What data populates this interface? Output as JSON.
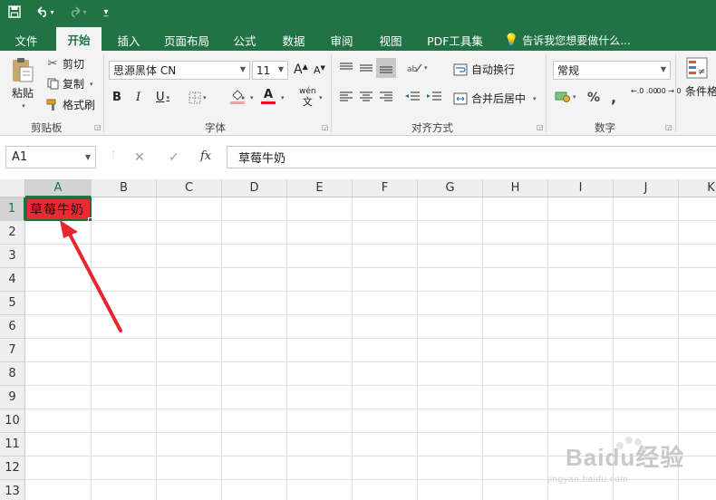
{
  "quick_access": {
    "save_icon": "save-icon",
    "undo_icon": "undo-icon",
    "redo_icon": "redo-icon",
    "customize_icon": "customize-icon"
  },
  "tabs": [
    {
      "label": "文件",
      "active": false
    },
    {
      "label": "开始",
      "active": true
    },
    {
      "label": "插入",
      "active": false
    },
    {
      "label": "页面布局",
      "active": false
    },
    {
      "label": "公式",
      "active": false
    },
    {
      "label": "数据",
      "active": false
    },
    {
      "label": "审阅",
      "active": false
    },
    {
      "label": "视图",
      "active": false
    },
    {
      "label": "PDF工具集",
      "active": false
    }
  ],
  "tell_me": "告诉我您想要做什么...",
  "ribbon": {
    "clipboard": {
      "paste": "粘贴",
      "cut": "剪切",
      "copy": "复制",
      "format_painter": "格式刷",
      "label": "剪贴板"
    },
    "font": {
      "font_name": "思源黑体 CN",
      "font_size": "11",
      "bold": "B",
      "italic": "I",
      "underline": "U",
      "font_color_letter": "A",
      "grow": "A",
      "shrink": "A",
      "wen": "wén",
      "wen_char": "文",
      "label": "字体"
    },
    "alignment": {
      "wrap": "自动换行",
      "merge": "合并后居中",
      "label": "对齐方式"
    },
    "number": {
      "format": "常规",
      "percent": "%",
      "comma": ",",
      "inc_decimal": "←.0 .00",
      "dec_decimal": ".00 →.0",
      "label": "数字"
    },
    "styles": {
      "conditional": "条件格式"
    }
  },
  "formula_bar": {
    "name_box": "A1",
    "cancel": "✕",
    "enter": "✓",
    "fx": "fx",
    "content": "草莓牛奶"
  },
  "grid": {
    "columns": [
      "A",
      "B",
      "C",
      "D",
      "E",
      "F",
      "G",
      "H",
      "I",
      "J",
      "K"
    ],
    "rows": [
      "1",
      "2",
      "3",
      "4",
      "5",
      "6",
      "7",
      "8",
      "9",
      "10",
      "11",
      "12",
      "13"
    ],
    "selected_cell": "A1",
    "a1_value": "草莓牛奶",
    "a1_fill": "#e92a34"
  },
  "annotation": {
    "arrow_color": "#e8262d"
  },
  "watermark": {
    "brand": "Baidu经验",
    "url": "jingyan.baidu.com"
  },
  "colors": {
    "accent": "#217346",
    "ribbon_bg": "#f3f3f3"
  }
}
